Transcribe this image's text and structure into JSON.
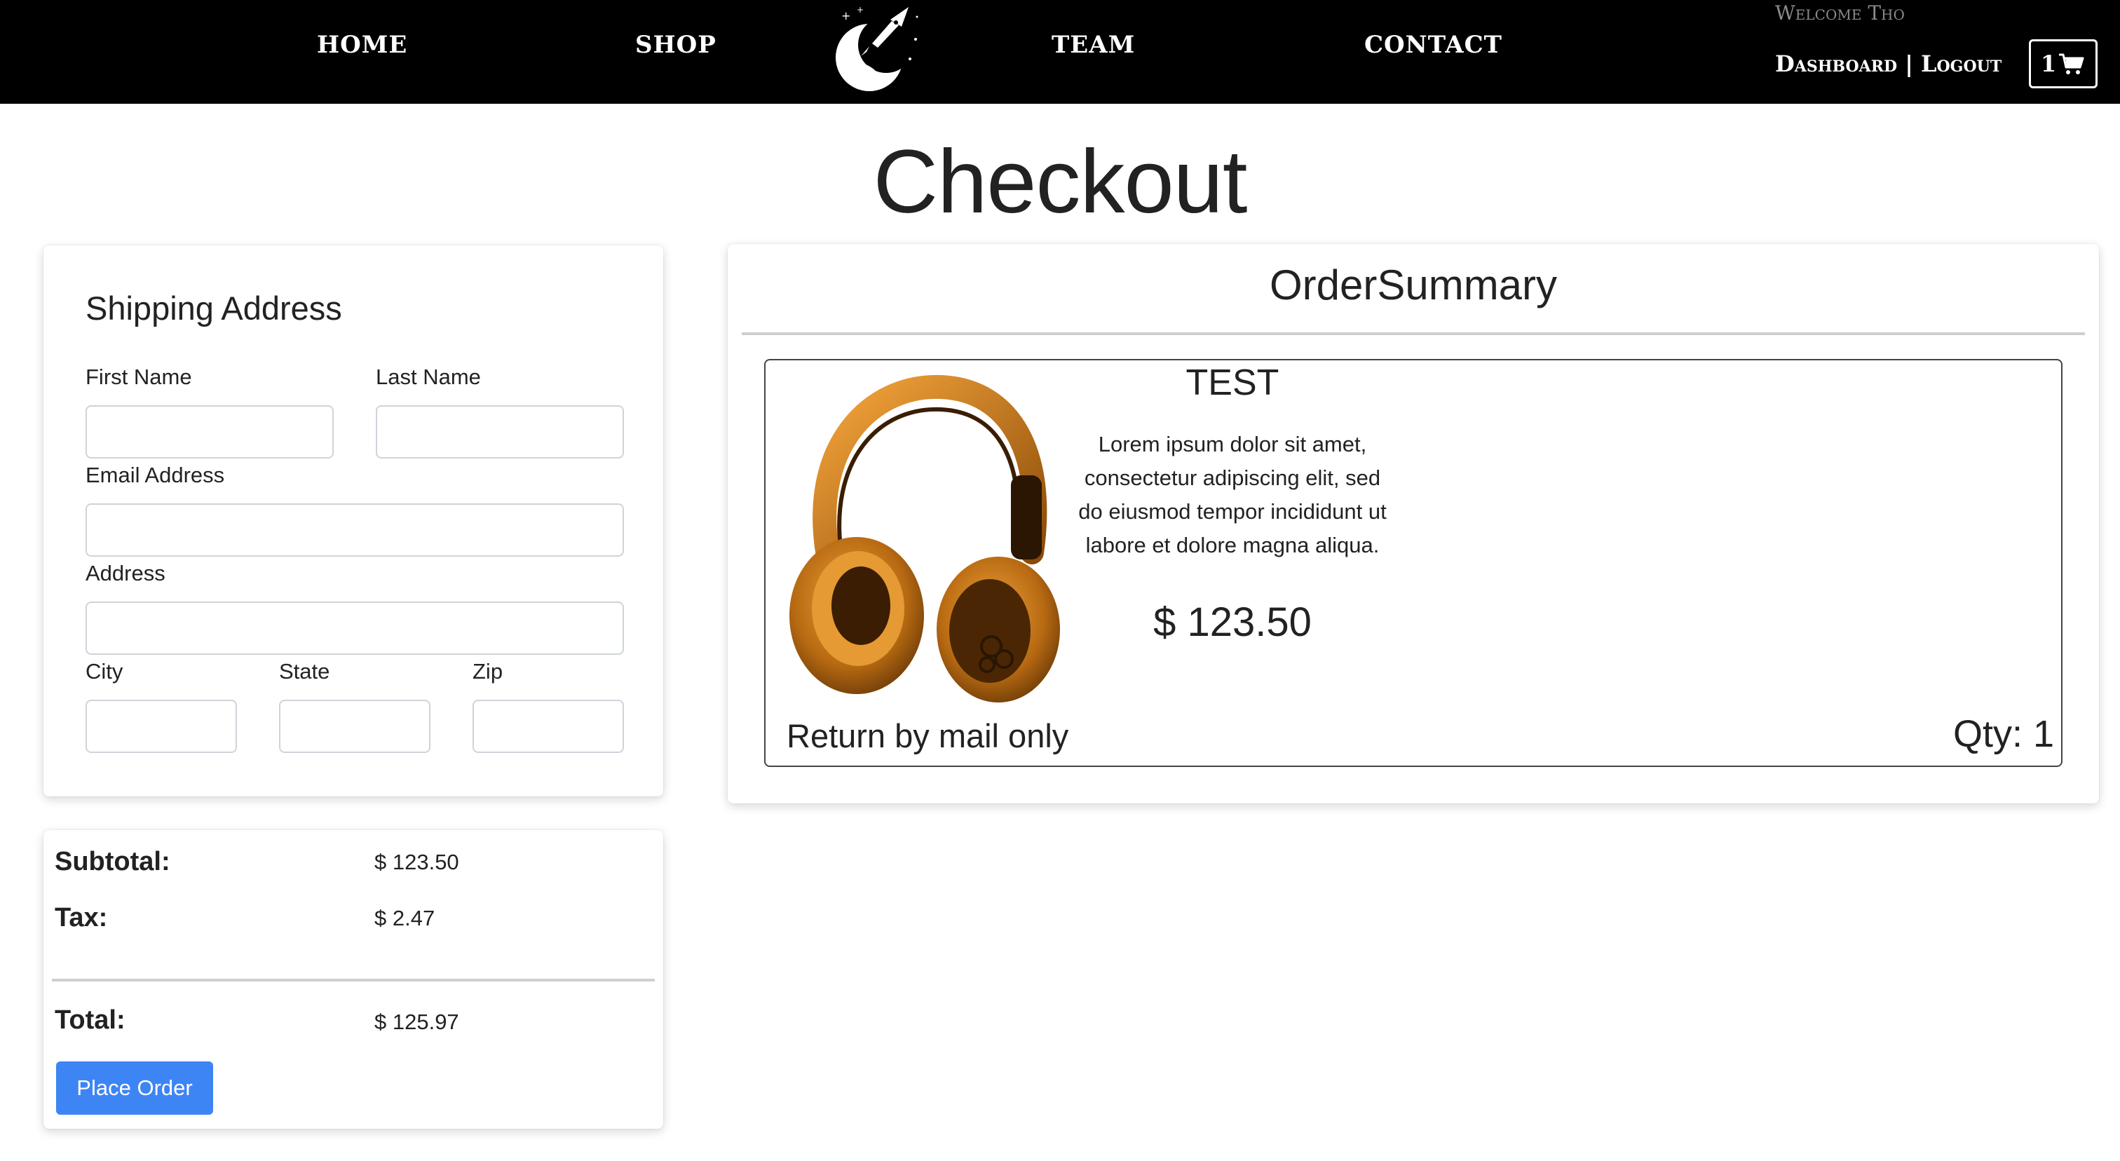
{
  "nav": {
    "home": "HOME",
    "shop": "SHOP",
    "team": "TEAM",
    "contact": "CONTACT",
    "welcome": "Welcome Tho",
    "dashboard": "Dashboard",
    "separator": "|",
    "logout": "Logout",
    "cart_count": "1"
  },
  "page": {
    "title": "Checkout"
  },
  "shipping": {
    "heading": "Shipping Address",
    "first_name_label": "First Name",
    "first_name_value": "",
    "last_name_label": "Last Name",
    "last_name_value": "",
    "email_label": "Email Address",
    "email_value": "",
    "address_label": "Address",
    "address_value": "",
    "city_label": "City",
    "city_value": "",
    "state_label": "State",
    "state_value": "",
    "zip_label": "Zip",
    "zip_value": ""
  },
  "totals": {
    "subtotal_label": "Subtotal:",
    "subtotal_value": "$ 123.50",
    "tax_label": "Tax:",
    "tax_value": "$ 2.47",
    "total_label": "Total:",
    "total_value": "$ 125.97",
    "place_order_label": "Place Order"
  },
  "summary": {
    "heading": "OrderSummary",
    "item": {
      "name": "TEST",
      "description": "Lorem ipsum dolor sit amet, consectetur adipiscing elit, sed do eiusmod tempor incididunt ut labore et dolore magna aliqua.",
      "price": "$ 123.50",
      "return_policy": "Return by mail only",
      "quantity": "Qty: 1",
      "image_icon": "headphones-image"
    }
  },
  "colors": {
    "navbar_bg": "#000000",
    "primary_button": "#3d85f5",
    "headphones": "#d9821f"
  }
}
